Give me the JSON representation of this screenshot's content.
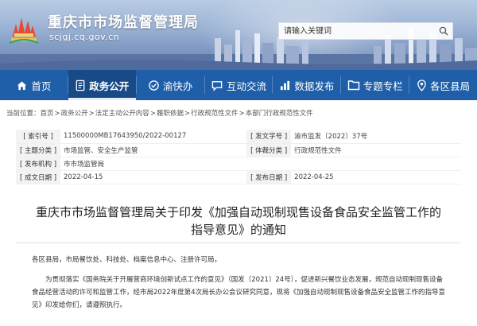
{
  "header": {
    "site_title": "重庆市市场监督管理局",
    "site_domain": "scjgj.cq.gov.cn",
    "search": {
      "placeholder": "请输入关键词"
    }
  },
  "nav": {
    "items": [
      {
        "label": "首页",
        "icon": "home-icon"
      },
      {
        "label": "政务公开",
        "icon": "document-icon",
        "active": true
      },
      {
        "label": "渝快办",
        "icon": "chongqing-service-icon"
      },
      {
        "label": "互动交流",
        "icon": "chat-icon"
      },
      {
        "label": "数据发布",
        "icon": "chart-icon"
      },
      {
        "label": "专题专栏",
        "icon": "folder-icon"
      },
      {
        "label": "各区县局",
        "icon": "map-pin-icon"
      }
    ]
  },
  "breadcrumb": {
    "prefix": "当前位置：",
    "items": [
      "首页",
      "政务公开",
      "法定主动公开内容",
      "履职依据",
      "行政规范性文件",
      "本部门行政规范性文件"
    ],
    "separator": ">"
  },
  "info": {
    "index_label": "[ 索引号 ]",
    "index_value": "11500000MB17643950/2022-00127",
    "doc_no_label": "[ 发文字号 ]",
    "doc_no_value": "渝市监发〔2022〕37号",
    "topic_label": "[ 主题分类 ]",
    "topic_value": "市场监管、安全生产监管",
    "genre_label": "[ 体裁分类 ]",
    "genre_value": "行政规范性文件",
    "issuer_label": "[ 发布机构 ]",
    "issuer_value": "市市场监管局",
    "date_label": "[ 成文日期 ]",
    "date_value": "2022-04-15",
    "pub_label": "[ 发布日期 ]",
    "pub_value": "2022-04-25"
  },
  "article": {
    "title": "重庆市市场监督管理局关于印发《加强自动现制现售设备食品安全监管工作的指导意见》的通知",
    "addressee": "各区县局，市局餐饮处、科技处、档案信息中心、注册许可局，",
    "body": "为贯彻落实《国务院关于开展营商环境创新试点工作的意见》（国发〔2021〕24号），促进新兴餐饮业态发展，规范自动现制现售设备食品经营活动的许可和监管工作，经市局2022年度第4次局长办公会议研究同意，现将《加强自动现制现售设备食品安全监管工作的指导意见》印发给你们，请遵照执行。"
  },
  "colors": {
    "nav_bg": "#1f5ea8",
    "nav_active": "#174a87",
    "banner_top": "#b9cbe3",
    "banner_bottom": "#6f89b6"
  }
}
